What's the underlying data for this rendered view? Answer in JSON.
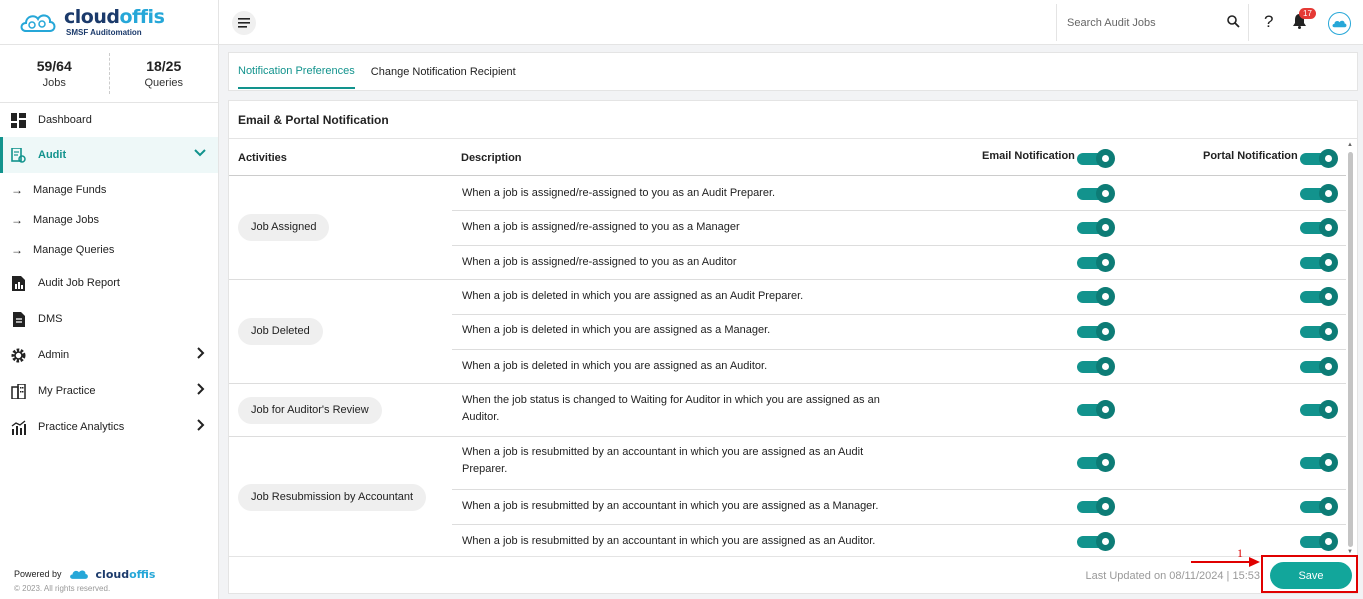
{
  "brand": {
    "name_part1": "cloud",
    "name_part2": "offis",
    "tagline": "SMSF Auditomation"
  },
  "stats": [
    {
      "value": "59/64",
      "label": "Jobs"
    },
    {
      "value": "18/25",
      "label": "Queries"
    }
  ],
  "nav": {
    "dashboard": "Dashboard",
    "audit": "Audit",
    "sub": [
      "Manage Funds",
      "Manage Jobs",
      "Manage Queries"
    ],
    "audit_job_report": "Audit Job Report",
    "dms": "DMS",
    "admin": "Admin",
    "my_practice": "My Practice",
    "practice_analytics": "Practice Analytics"
  },
  "powered": {
    "label": "Powered by",
    "copyright": "© 2023. All rights reserved."
  },
  "header": {
    "search_placeholder": "Search Audit Jobs",
    "help": "?",
    "notification_count": "17"
  },
  "tabs": [
    "Notification Preferences",
    "Change Notification Recipient"
  ],
  "card": {
    "title": "Email & Portal Notification",
    "columns": {
      "activities": "Activities",
      "description": "Description",
      "email": "Email Notification",
      "portal": "Portal Notification"
    },
    "header_email_on": true,
    "header_portal_on": true
  },
  "groups": [
    {
      "activity": "Job Assigned",
      "rows": [
        {
          "desc": "When a job is assigned/re-assigned to you as an Audit Preparer.",
          "email": true,
          "portal": true
        },
        {
          "desc": "When a job is assigned/re-assigned to you as a Manager",
          "email": true,
          "portal": true
        },
        {
          "desc": "When a job is assigned/re-assigned to you as an Auditor",
          "email": true,
          "portal": true
        }
      ]
    },
    {
      "activity": "Job Deleted",
      "rows": [
        {
          "desc": "When a job is deleted in which you are assigned as an Audit Preparer.",
          "email": true,
          "portal": true
        },
        {
          "desc": "When a job is deleted in which you are assigned as a Manager.",
          "email": true,
          "portal": true
        },
        {
          "desc": "When a job is deleted in which you are assigned as an Auditor.",
          "email": true,
          "portal": true
        }
      ]
    },
    {
      "activity": "Job for Auditor's Review",
      "rows": [
        {
          "desc": "When the job status is changed to Waiting for Auditor in which you are assigned as an Auditor.",
          "email": true,
          "portal": true
        }
      ]
    },
    {
      "activity": "Job Resubmission by Accountant",
      "rows": [
        {
          "desc": "When a job is resubmitted by an accountant in which you are assigned as an Audit Preparer.",
          "email": true,
          "portal": true
        },
        {
          "desc": "When a job is resubmitted by an accountant in which you are assigned as a Manager.",
          "email": true,
          "portal": true
        },
        {
          "desc": "When a job is resubmitted by an accountant in which you are assigned as an Auditor.",
          "email": true,
          "portal": true
        }
      ]
    }
  ],
  "footer": {
    "last_updated": "Last Updated on 08/11/2024 | 15:53",
    "save": "Save"
  },
  "annotation": {
    "number": "1"
  },
  "colors": {
    "accent": "#12938d",
    "toggle_knob": "#0d7c76",
    "annotation": "#e00000",
    "brand_dark": "#1b3a6b",
    "brand_light": "#26a7d8"
  }
}
